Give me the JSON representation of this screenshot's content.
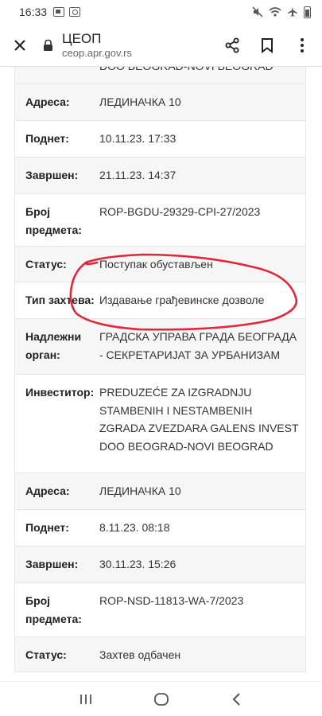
{
  "status_bar": {
    "time": "16:33"
  },
  "toolbar": {
    "title": "ЦЕОП",
    "url": "ceop.apr.gov.rs"
  },
  "records": [
    {
      "rows": [
        {
          "key": "",
          "value": "DOO BEOGRAD-NOVI BEOGRAD"
        },
        {
          "key": "Адреса:",
          "value": "ЛЕДИНАЧКА 10"
        },
        {
          "key": "Поднет:",
          "value": "10.11.23. 17:33"
        },
        {
          "key": "Завршен:",
          "value": "21.11.23. 14:37"
        },
        {
          "key": "Број предмета:",
          "value": "ROP-BGDU-29329-CPI-27/2023"
        },
        {
          "key": "Статус:",
          "value": "Поступак обустављен"
        },
        {
          "key": "Тип захтева:",
          "value": "Издавање грађевинске дозволе"
        },
        {
          "key": "Надлежни орган:",
          "value": "ГРАДСКА УПРАВА ГРАДА БЕОГРАДА - СЕКРЕТАРИЈАТ ЗА УРБАНИЗАМ"
        },
        {
          "key": "Инвеститор:",
          "value": "PREDUZEĆE ZA IZGRADNJU STAMBENIH I NESTAMBENIH ZGRADA ZVEZDARA GALENS INVEST DOO BEOGRAD-NOVI BEOGRAD"
        },
        {
          "key": "Адреса:",
          "value": "ЛЕДИНАЧКА 10"
        },
        {
          "key": "Поднет:",
          "value": "8.11.23. 08:18"
        },
        {
          "key": "Завршен:",
          "value": "30.11.23. 15:26"
        },
        {
          "key": "Број предмета:",
          "value": "ROP-NSD-11813-WA-7/2023"
        },
        {
          "key": "Статус:",
          "value": "Захтев одбачен"
        }
      ]
    }
  ],
  "annotation_color": "#e0283a"
}
